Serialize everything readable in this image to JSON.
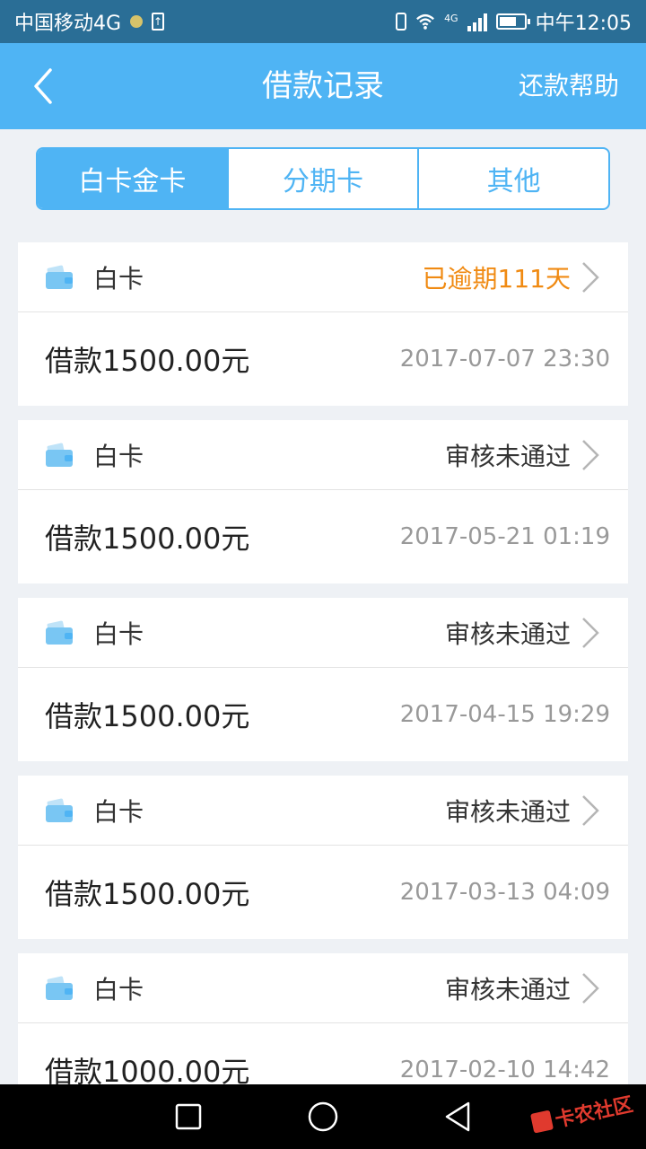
{
  "status_bar": {
    "carrier": "中国移动4G",
    "network": "4G",
    "time": "中午12:05"
  },
  "header": {
    "title": "借款记录",
    "help_label": "还款帮助"
  },
  "tabs": [
    {
      "label": "白卡金卡",
      "active": true
    },
    {
      "label": "分期卡",
      "active": false
    },
    {
      "label": "其他",
      "active": false
    }
  ],
  "records": [
    {
      "card_type": "白卡",
      "status": "已逾期111天",
      "amount": "借款1500.00元",
      "time": "2017-07-07 23:30"
    },
    {
      "card_type": "白卡",
      "status": "审核未通过",
      "amount": "借款1500.00元",
      "time": "2017-05-21 01:19"
    },
    {
      "card_type": "白卡",
      "status": "审核未通过",
      "amount": "借款1500.00元",
      "time": "2017-04-15 19:29"
    },
    {
      "card_type": "白卡",
      "status": "审核未通过",
      "amount": "借款1500.00元",
      "time": "2017-03-13 04:09"
    },
    {
      "card_type": "白卡",
      "status": "审核未通过",
      "amount": "借款1000.00元",
      "time": "2017-02-10 14:42"
    }
  ],
  "watermark": "卡农社区",
  "colors": {
    "primary": "#4fb4f4",
    "status_bar": "#2a6e96",
    "overdue": "#f08a12",
    "background": "#eef1f5"
  },
  "battery_level": 0.7,
  "icons": [
    "back-arrow-icon",
    "wallet-icon",
    "chevron-right-icon",
    "recent-apps-icon",
    "home-icon",
    "back-icon"
  ]
}
